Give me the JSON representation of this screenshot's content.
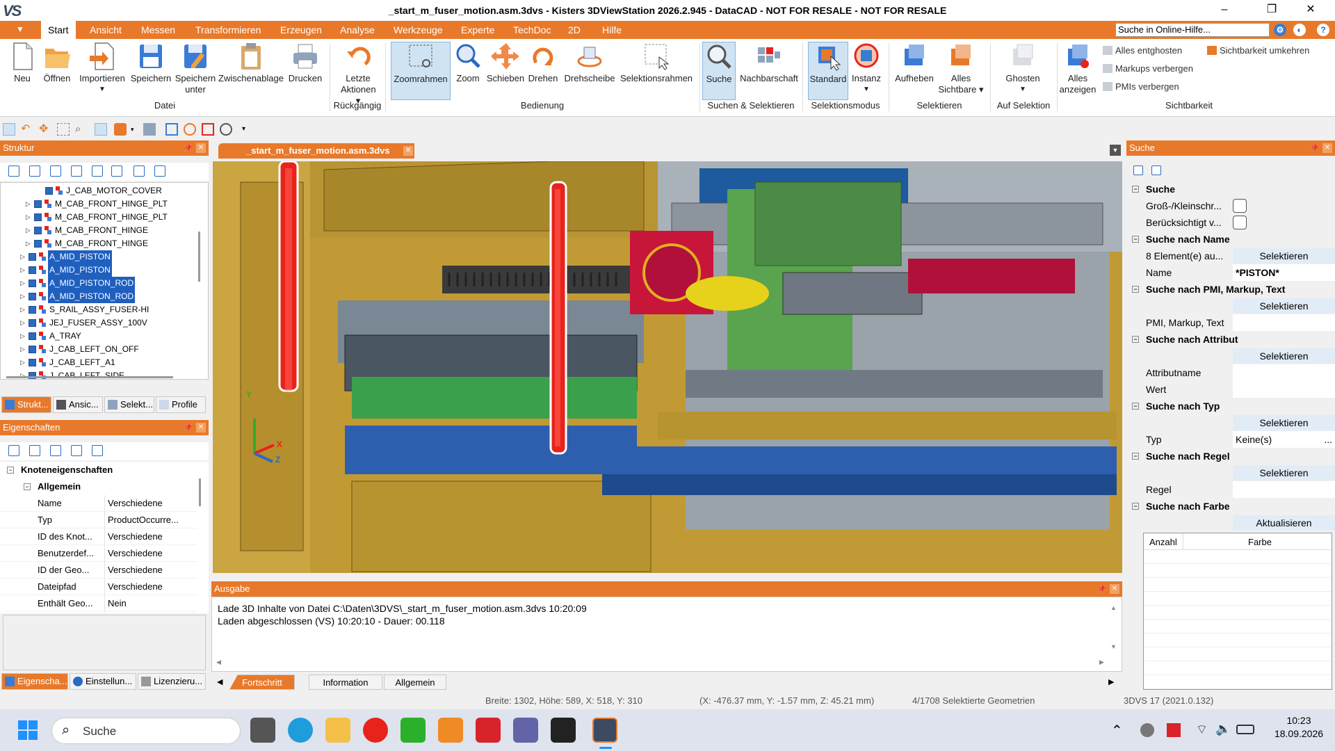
{
  "window": {
    "title": "_start_m_fuser_motion.asm.3dvs - Kisters 3DViewStation 2026.2.945 - DataCAD - NOT FOR RESALE - NOT FOR RESALE",
    "logo_text": "VS",
    "controls": {
      "minimize": "–",
      "restore": "❐",
      "close": "✕"
    }
  },
  "menubar": {
    "quick_access": "▼",
    "tabs": [
      "Start",
      "Ansicht",
      "Messen",
      "Transformieren",
      "Erzeugen",
      "Analyse",
      "Werkzeuge",
      "Experte",
      "TechDoc",
      "2D",
      "Hilfe"
    ],
    "active_tab": "Start",
    "help_search": "Suche in Online-Hilfe..."
  },
  "ribbon": {
    "buttons": {
      "neu": "Neu",
      "oeffnen": "Öffnen",
      "importieren": "Importieren",
      "speichern": "Speichern",
      "speichern_unter_1": "Speichern",
      "speichern_unter_2": "unter",
      "zwischenablage": "Zwischenablage",
      "drucken": "Drucken",
      "letzte_1": "Letzte",
      "letzte_2": "Aktionen",
      "zoomrahmen": "Zoomrahmen",
      "zoom": "Zoom",
      "schieben": "Schieben",
      "drehen": "Drehen",
      "drehscheibe": "Drehscheibe",
      "selektionsrahmen": "Selektionsrahmen",
      "suche": "Suche",
      "nachbarschaft": "Nachbarschaft",
      "standard": "Standard",
      "instanz": "Instanz",
      "aufheben": "Aufheben",
      "alles_sichtbare_1": "Alles",
      "alles_sichtbare_2": "Sichtbare",
      "ghosten": "Ghosten",
      "alles_anzeigen_1": "Alles",
      "alles_anzeigen_2": "anzeigen",
      "alles_entghosten": "Alles entghosten",
      "markups_verbergen": "Markups verbergen",
      "pmis_verbergen": "PMIs verbergen",
      "sichtbarkeit_umkehren": "Sichtbarkeit umkehren"
    },
    "groups": {
      "datei": "Datei",
      "rueckgaengig": "Rückgängig",
      "bedienung": "Bedienung",
      "suchen": "Suchen & Selektieren",
      "selektionsmodus": "Selektionsmodus",
      "selektieren": "Selektieren",
      "auf_selektion": "Auf Selektion",
      "sichtbarkeit": "Sichtbarkeit"
    }
  },
  "structure_panel": {
    "title": "Struktur",
    "rows": [
      {
        "label": "J_CAB_MOTOR_COVER",
        "indent": 3,
        "expander": false,
        "highlighted": false
      },
      {
        "label": "M_CAB_FRONT_HINGE_PLT",
        "indent": 2,
        "expander": true,
        "highlighted": false
      },
      {
        "label": "M_CAB_FRONT_HINGE_PLT",
        "indent": 2,
        "expander": true,
        "highlighted": false
      },
      {
        "label": "M_CAB_FRONT_HINGE",
        "indent": 2,
        "expander": true,
        "highlighted": false
      },
      {
        "label": "M_CAB_FRONT_HINGE",
        "indent": 2,
        "expander": true,
        "highlighted": false
      },
      {
        "label": "A_MID_PISTON",
        "indent": 1,
        "expander": true,
        "highlighted": true
      },
      {
        "label": "A_MID_PISTON",
        "indent": 1,
        "expander": true,
        "highlighted": true
      },
      {
        "label": "A_MID_PISTON_ROD",
        "indent": 1,
        "expander": true,
        "highlighted": true
      },
      {
        "label": "A_MID_PISTON_ROD",
        "indent": 1,
        "expander": true,
        "highlighted": true
      },
      {
        "label": "S_RAIL_ASSY_FUSER-HI",
        "indent": 1,
        "expander": true,
        "highlighted": false
      },
      {
        "label": "JEJ_FUSER_ASSY_100V",
        "indent": 1,
        "expander": true,
        "highlighted": false
      },
      {
        "label": "A_TRAY",
        "indent": 1,
        "expander": true,
        "highlighted": false
      },
      {
        "label": "J_CAB_LEFT_ON_OFF",
        "indent": 1,
        "expander": true,
        "highlighted": false
      },
      {
        "label": "J_CAB_LEFT_A1",
        "indent": 1,
        "expander": true,
        "highlighted": false
      },
      {
        "label": "J_CAB_LEFT_SIDE",
        "indent": 1,
        "expander": true,
        "highlighted": false
      }
    ],
    "tabs": [
      "Strukt...",
      "Ansic...",
      "Selekt...",
      "Profile"
    ],
    "active_tab": "Strukt..."
  },
  "properties_panel": {
    "title": "Eigenschaften",
    "section": "Knoteneigenschaften",
    "subsection": "Allgemein",
    "rows": [
      {
        "key": "Name",
        "value": "Verschiedene"
      },
      {
        "key": "Typ",
        "value": "ProductOccurre..."
      },
      {
        "key": "ID des Knot...",
        "value": "Verschiedene"
      },
      {
        "key": "Benutzerdef...",
        "value": "Verschiedene"
      },
      {
        "key": "ID der Geo...",
        "value": "Verschiedene"
      },
      {
        "key": "Dateipfad",
        "value": "Verschiedene"
      },
      {
        "key": "Enthält Geo...",
        "value": "Nein"
      }
    ],
    "tabs": [
      "Eigenscha...",
      "Einstellun...",
      "Lizenzieru..."
    ],
    "active_tab": "Eigenscha..."
  },
  "document": {
    "tab_label": "_start_m_fuser_motion.asm.3dvs",
    "axis_labels": {
      "x": "X",
      "y": "Y",
      "z": "Z"
    }
  },
  "output_panel": {
    "title": "Ausgabe",
    "lines": [
      "Lade 3D Inhalte von Datei C:\\Daten\\3DVS\\_start_m_fuser_motion.asm.3dvs 10:20:09",
      "Laden abgeschlossen (VS) 10:20:10 - Dauer: 00.118"
    ],
    "tabs": [
      "Fortschritt",
      "Information",
      "Allgemein"
    ],
    "active_tab": "Fortschritt"
  },
  "search_panel": {
    "title": "Suche",
    "suche_header": "Suche",
    "gross_klein": "Groß-/Kleinschr...",
    "beruecksichtigt": "Berücksichtigt v...",
    "by_name_header": "Suche nach Name",
    "element_count": "8 Element(e) au...",
    "selektieren": "Selektieren",
    "name_label": "Name",
    "name_value": "*PISTON*",
    "by_pmi_header": "Suche nach PMI, Markup, Text",
    "pmi_label": "PMI, Markup, Text",
    "by_attr_header": "Suche nach Attribut",
    "attr_name": "Attributname",
    "attr_value": "Wert",
    "by_type_header": "Suche nach Typ",
    "type_label": "Typ",
    "type_value": "Keine(s)",
    "type_more": "...",
    "by_rule_header": "Suche nach Regel",
    "rule_label": "Regel",
    "by_color_header": "Suche nach Farbe",
    "aktualisieren": "Aktualisieren",
    "col_count": "Anzahl",
    "col_color": "Farbe"
  },
  "statusbar": {
    "dims": "Breite: 1302, Höhe: 589, X: 518, Y: 310",
    "coords": "(X: -476.37 mm, Y: -1.57 mm, Z: 45.21 mm)",
    "selection": "4/1708 Selektierte Geometrien",
    "version": "3DVS 17 (2021.0.132)"
  },
  "taskbar": {
    "search_placeholder": "Suche",
    "time": "10:23",
    "date": "18.09.2026",
    "tray_caret": "⌃"
  },
  "colors": {
    "accent": "#e8792a",
    "selection": "#1f5fbf",
    "piston": "#e8231c",
    "chassis": "#c7a23d"
  }
}
